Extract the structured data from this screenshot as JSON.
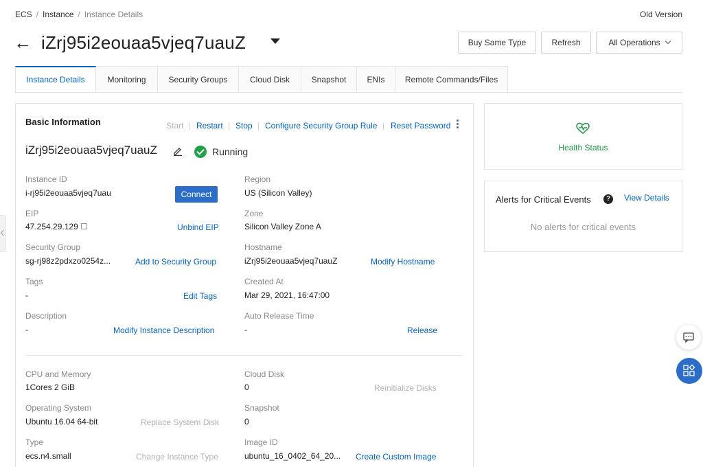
{
  "breadcrumb": {
    "items": [
      "ECS",
      "Instance",
      "Instance Details"
    ]
  },
  "old_version": "Old Version",
  "title": "iZrj95i2eouaa5vjeq7uauZ",
  "header_buttons": {
    "buy_same_type": "Buy Same Type",
    "refresh": "Refresh",
    "all_operations": "All Operations"
  },
  "tabs": [
    "Instance Details",
    "Monitoring",
    "Security Groups",
    "Cloud Disk",
    "Snapshot",
    "ENIs",
    "Remote Commands/Files"
  ],
  "basic": {
    "heading": "Basic Information",
    "actions": {
      "start": "Start",
      "restart": "Restart",
      "stop": "Stop",
      "configure_sg_rule": "Configure Security Group Rule",
      "reset_password": "Reset Password"
    },
    "instance_name": "iZrj95i2eouaa5vjeq7uauZ",
    "status": "Running",
    "fields": {
      "instance_id": {
        "label": "Instance ID",
        "value": "i-rj95i2eouaa5vjeq7uau",
        "action": "Connect"
      },
      "region": {
        "label": "Region",
        "value": "US (Silicon Valley)"
      },
      "eip": {
        "label": "EIP",
        "value": "47.254.29.129",
        "action": "Unbind EIP"
      },
      "zone": {
        "label": "Zone",
        "value": "Silicon Valley Zone A"
      },
      "security_group": {
        "label": "Security Group",
        "value": "sg-rj98z2pdxzo0254z...",
        "action": "Add to Security Group"
      },
      "hostname": {
        "label": "Hostname",
        "value": "iZrj95i2eouaa5vjeq7uauZ",
        "action": "Modify Hostname"
      },
      "tags": {
        "label": "Tags",
        "value": "-",
        "action": "Edit Tags"
      },
      "created_at": {
        "label": "Created At",
        "value": "Mar 29, 2021, 16:47:00"
      },
      "description": {
        "label": "Description",
        "value": "-",
        "action": "Modify Instance Description"
      },
      "auto_release": {
        "label": "Auto Release Time",
        "value": "-",
        "action": "Release"
      },
      "cpu_memory": {
        "label": "CPU and Memory",
        "value": "1Cores 2 GiB"
      },
      "cloud_disk": {
        "label": "Cloud Disk",
        "value": "0",
        "action": "Reinitialize Disks"
      },
      "os": {
        "label": "Operating System",
        "value": "Ubuntu 16.04 64-bit",
        "action": "Replace System Disk"
      },
      "snapshot": {
        "label": "Snapshot",
        "value": "0"
      },
      "type": {
        "label": "Type",
        "value": "ecs.n4.small",
        "action": "Change Instance Type"
      },
      "image_id": {
        "label": "Image ID",
        "value": "ubuntu_16_0402_64_20...",
        "action": "Create Custom Image"
      }
    }
  },
  "health": {
    "label": "Health Status"
  },
  "alerts": {
    "title": "Alerts for Critical Events",
    "view_details": "View Details",
    "empty": "No alerts for critical events"
  },
  "colors": {
    "link": "#0064c8",
    "primary_button": "#2b6dc9",
    "running": "#22a04a",
    "health": "#1b9448"
  }
}
